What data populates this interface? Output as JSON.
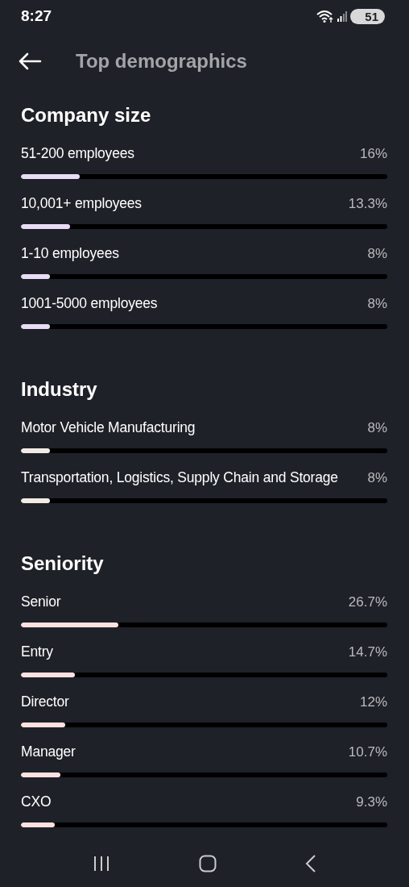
{
  "status_bar": {
    "time": "8:27",
    "battery": "51"
  },
  "header": {
    "title": "Top demographics"
  },
  "sections": [
    {
      "title": "Company size",
      "color": "#e9ddf6",
      "rows": [
        {
          "label": "51-200 employees",
          "value": "16%",
          "level": 0.16
        },
        {
          "label": "10,001+ employees",
          "value": "13.3%",
          "level": 0.133
        },
        {
          "label": "1-10 employees",
          "value": "8%",
          "level": 0.08
        },
        {
          "label": "1001-5000 employees",
          "value": "8%",
          "level": 0.08
        }
      ]
    },
    {
      "title": "Industry",
      "color": "#f1ebe6",
      "rows": [
        {
          "label": "Motor Vehicle Manufacturing",
          "value": "8%",
          "level": 0.08
        },
        {
          "label": "Transportation, Logistics, Supply Chain and Storage",
          "value": "8%",
          "level": 0.08
        }
      ]
    },
    {
      "title": "Seniority",
      "color": "#fde1e1",
      "rows": [
        {
          "label": "Senior",
          "value": "26.7%",
          "level": 0.267
        },
        {
          "label": "Entry",
          "value": "14.7%",
          "level": 0.147
        },
        {
          "label": "Director",
          "value": "12%",
          "level": 0.12
        },
        {
          "label": "Manager",
          "value": "10.7%",
          "level": 0.107
        },
        {
          "label": "CXO",
          "value": "9.3%",
          "level": 0.093
        }
      ]
    }
  ]
}
